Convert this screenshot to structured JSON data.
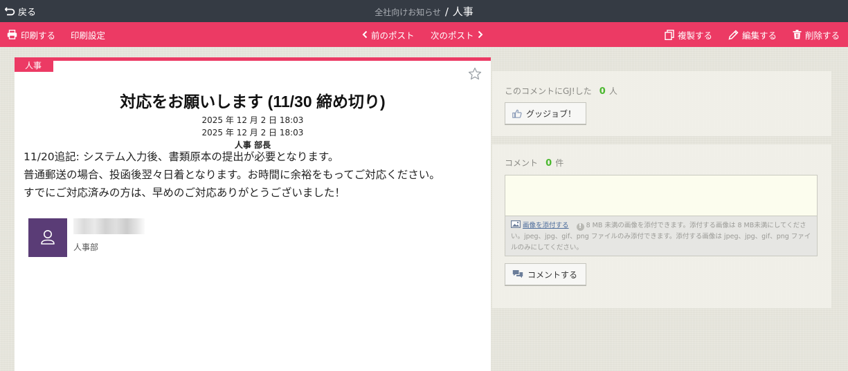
{
  "header": {
    "back_label": "戻る",
    "category": "全社向けお知らせ",
    "separator": "/",
    "board_name": "人事"
  },
  "toolbar": {
    "print_label": "印刷する",
    "print_settings_label": "印刷設定",
    "prev_label": "前のポスト",
    "next_label": "次のポスト",
    "duplicate_label": "複製する",
    "edit_label": "編集する",
    "delete_label": "削除する"
  },
  "post": {
    "category_tag": "人事",
    "title": "対応をお願いします (11/30 締め切り)",
    "created_at": "2025 年 12 月 2 日 18:03",
    "updated_at": "2025 年 12 月 2 日 18:03",
    "author_role": "人事 部長",
    "body_lines": [
      "11/20追記: システム入力後、書類原本の提出が必要となります。",
      "普通郵送の場合、投函後翌々日着となります。お時間に余裕をもってご対応ください。",
      "すでにご対応済みの方は、早めのご対応ありがとうございました！"
    ],
    "author_department": "人事部"
  },
  "gj": {
    "label": "このコメントにGJ!した",
    "count": "0",
    "unit": "人",
    "button_label": "グッジョブ！"
  },
  "comments": {
    "label": "コメント",
    "count": "0",
    "unit": "件",
    "attach_link": "画像を添付する",
    "attach_note": "8 MB 未満の画像を添付できます。添付する画像は 8 MB未満にしてください。jpeg、jpg、gif、png ファイルのみ添付できます。添付する画像は jpeg、jpg、gif、png ファイルのみにしてください。",
    "submit_label": "コメントする"
  },
  "colors": {
    "topbar": "#353b44",
    "accent_pink": "#ec3a64",
    "avatar_purple": "#5a3c76",
    "count_green": "#4bb82f"
  }
}
